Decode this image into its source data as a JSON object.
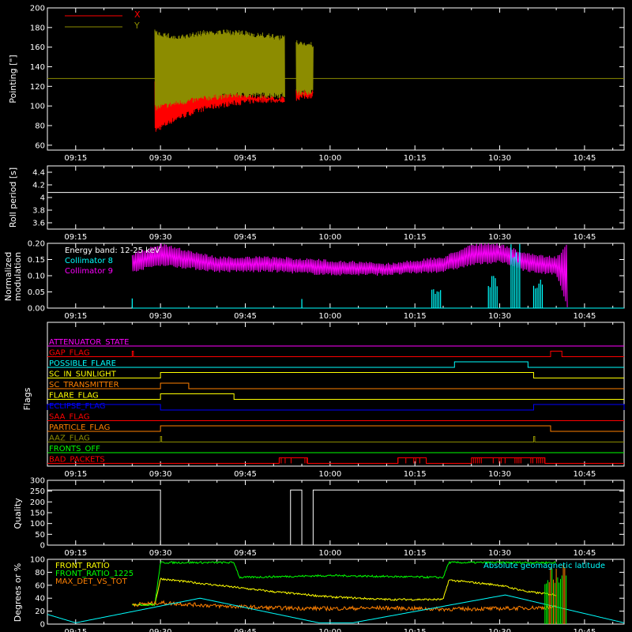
{
  "time_axis": {
    "range": [
      "09:10",
      "10:52"
    ],
    "tick_labels": [
      "09:15",
      "09:30",
      "09:45",
      "10:00",
      "10:15",
      "10:30",
      "10:45"
    ]
  },
  "colors": {
    "background": "#000000",
    "axes": "#ffffff",
    "red": "#ff0000",
    "olive": "#8c8c00",
    "cyan": "#00ffff",
    "magenta": "#ff00ff",
    "yellow": "#ffff00",
    "orange": "#ff8000",
    "blue": "#0000ff",
    "green": "#00ff00",
    "white": "#ffffff"
  },
  "chart_data": [
    {
      "id": "pointing",
      "type": "line",
      "title": "",
      "ylabel": "Pointing [\"]",
      "ylim": [
        55,
        200
      ],
      "y_ticks": [
        60,
        80,
        100,
        120,
        140,
        160,
        180,
        200
      ],
      "legend": {
        "placement": "top-left",
        "entries": [
          "X",
          "Y"
        ]
      },
      "series": [
        {
          "name": "X",
          "color": "red",
          "segments": [
            {
              "x": [
                "09:29",
                "09:33",
                "09:38",
                "09:43",
                "09:48",
                "09:52"
              ],
              "low": [
                72,
                85,
                95,
                100,
                103,
                103
              ],
              "high": [
                125,
                125,
                118,
                115,
                112,
                110
              ]
            },
            {
              "x": [
                "09:54",
                "09:57"
              ],
              "low": [
                105,
                108
              ],
              "high": [
                118,
                118
              ]
            }
          ]
        },
        {
          "name": "Y",
          "color": "olive",
          "segments": [
            {
              "x": [
                "09:29",
                "09:33",
                "09:38",
                "09:43",
                "09:48",
                "09:52"
              ],
              "low": [
                95,
                100,
                105,
                108,
                108,
                108
              ],
              "high": [
                178,
                172,
                178,
                178,
                175,
                172
              ]
            },
            {
              "x": [
                "09:54",
                "09:57"
              ],
              "low": [
                110,
                112
              ],
              "high": [
                168,
                165
              ]
            }
          ]
        },
        {
          "name": "reference",
          "color": "olive",
          "x": [
            "09:10",
            "10:52"
          ],
          "y": [
            128,
            128
          ]
        }
      ]
    },
    {
      "id": "roll",
      "type": "line",
      "ylabel": "Roll period [s]",
      "ylim": [
        3.5,
        4.5
      ],
      "y_ticks": [
        3.6,
        3.8,
        4.0,
        4.2,
        4.4
      ],
      "series": [
        {
          "color": "white",
          "x": [
            "09:10",
            "10:52"
          ],
          "y": [
            4.08,
            4.08
          ]
        }
      ]
    },
    {
      "id": "modulation",
      "type": "line",
      "ylabel": [
        "Normalized",
        "modulation"
      ],
      "ylim": [
        0,
        0.2
      ],
      "y_ticks": [
        0.0,
        0.05,
        0.1,
        0.15,
        0.2
      ],
      "y_tick_labels": [
        "0.00",
        "0.05",
        "0.10",
        "0.15",
        "0.20"
      ],
      "annotations": [
        "Energy band: 12-25 keV"
      ],
      "legend": {
        "placement": "top-left",
        "entries": [
          "Collimator 8",
          "Collimator 9"
        ]
      },
      "series": [
        {
          "name": "Collimator 9",
          "color": "magenta",
          "x": [
            "09:25",
            "09:30",
            "09:40",
            "09:50",
            "10:00",
            "10:10",
            "10:20",
            "10:25",
            "10:30",
            "10:35",
            "10:40",
            "10:42"
          ],
          "low": [
            0.11,
            0.13,
            0.11,
            0.11,
            0.1,
            0.1,
            0.11,
            0.13,
            0.14,
            0.11,
            0.1,
            0.0
          ],
          "high": [
            0.17,
            0.2,
            0.16,
            0.16,
            0.15,
            0.14,
            0.16,
            0.2,
            0.2,
            0.17,
            0.16,
            0.2
          ]
        },
        {
          "name": "Collimator 8",
          "color": "cyan",
          "x": [
            "09:25",
            "09:55",
            "10:18",
            "10:28",
            "10:32",
            "10:36"
          ],
          "spike_heights": [
            0.03,
            0.03,
            0.06,
            0.1,
            0.2,
            0.1
          ]
        }
      ]
    },
    {
      "id": "flags",
      "type": "line",
      "ylabel": "Flags",
      "flags": [
        {
          "label": "ATTENUATOR_STATE",
          "color": "magenta",
          "on": []
        },
        {
          "label": "GAP_FLAG",
          "color": "red",
          "on": [
            [
              "09:25",
              "09:25"
            ],
            [
              "10:39",
              "10:41"
            ]
          ]
        },
        {
          "label": "POSSIBLE_FLARE",
          "color": "cyan",
          "on": [
            [
              "10:22",
              "10:35"
            ]
          ]
        },
        {
          "label": "SC_IN_SUNLIGHT",
          "color": "yellow",
          "on": [
            [
              "09:30",
              "10:36"
            ]
          ]
        },
        {
          "label": "SC_TRANSMITTER",
          "color": "orange",
          "on": [
            [
              "09:30",
              "09:35"
            ]
          ]
        },
        {
          "label": "FLARE_FLAG",
          "color": "yellow",
          "on": [
            [
              "09:30",
              "09:43"
            ]
          ]
        },
        {
          "label": "ECLIPSE_FLAG",
          "color": "blue",
          "on": [
            [
              "09:10",
              "09:30"
            ],
            [
              "10:36",
              "10:52"
            ]
          ]
        },
        {
          "label": "SAA_FLAG",
          "color": "red",
          "on": []
        },
        {
          "label": "PARTICLE_FLAG",
          "color": "orange",
          "on": [
            [
              "09:30",
              "10:39"
            ]
          ]
        },
        {
          "label": "AAZ_FLAG",
          "color": "olive",
          "on": [
            [
              "09:30",
              "09:30"
            ],
            [
              "10:36",
              "10:36"
            ]
          ]
        },
        {
          "label": "FRONTS_OFF",
          "color": "green",
          "on": []
        },
        {
          "label": "BAD_PACKETS",
          "color": "red",
          "on": [
            [
              "09:51",
              "09:56"
            ],
            [
              "10:12",
              "10:17"
            ],
            [
              "10:25",
              "10:38"
            ]
          ]
        }
      ]
    },
    {
      "id": "quality",
      "type": "line",
      "ylabel": "Quality",
      "ylim": [
        0,
        300
      ],
      "y_ticks": [
        0,
        50,
        100,
        150,
        200,
        250,
        300
      ],
      "series": [
        {
          "color": "white",
          "x": [
            "09:10",
            "09:30",
            "09:30",
            "09:53",
            "09:53",
            "09:55",
            "09:55",
            "09:57",
            "09:57",
            "10:52"
          ],
          "y": [
            255,
            255,
            0,
            0,
            255,
            255,
            0,
            0,
            255,
            255
          ]
        }
      ]
    },
    {
      "id": "ratios",
      "type": "line",
      "ylabel": "Degrees or %",
      "ylim": [
        0,
        100
      ],
      "y_ticks": [
        0,
        20,
        40,
        60,
        80,
        100
      ],
      "legend": {
        "placement": "top-left",
        "entries": [
          "FRONT_RATIO",
          "FRONT_RATIO_1225",
          "MAX_DET_VS_TOT"
        ]
      },
      "annotations": [
        "Absolute geomagnetic latitude"
      ],
      "series": [
        {
          "name": "FRONT_RATIO",
          "color": "yellow",
          "x": [
            "09:25",
            "09:29",
            "09:30",
            "09:40",
            "09:50",
            "10:00",
            "10:10",
            "10:20",
            "10:21",
            "10:30",
            "10:35",
            "10:40"
          ],
          "y": [
            30,
            30,
            70,
            60,
            50,
            42,
            38,
            38,
            68,
            60,
            50,
            45
          ]
        },
        {
          "name": "FRONT_RATIO_1225",
          "color": "green",
          "x": [
            "09:25",
            "09:29",
            "09:30",
            "09:43",
            "09:44",
            "10:00",
            "10:20",
            "10:21",
            "10:35",
            "10:40"
          ],
          "y": [
            30,
            30,
            95,
            95,
            72,
            75,
            72,
            95,
            95,
            95
          ]
        },
        {
          "name": "MAX_DET_VS_TOT",
          "color": "orange",
          "x": [
            "09:25",
            "09:30",
            "09:40",
            "09:50",
            "10:00",
            "10:10",
            "10:20",
            "10:30",
            "10:40"
          ],
          "y": [
            30,
            33,
            28,
            25,
            24,
            25,
            23,
            24,
            26
          ]
        },
        {
          "name": "Absolute geomagnetic latitude",
          "color": "cyan",
          "x": [
            "09:10",
            "09:15",
            "09:37",
            "09:58",
            "10:04",
            "10:31",
            "10:52"
          ],
          "y": [
            15,
            2,
            40,
            2,
            2,
            45,
            2
          ]
        }
      ]
    }
  ]
}
